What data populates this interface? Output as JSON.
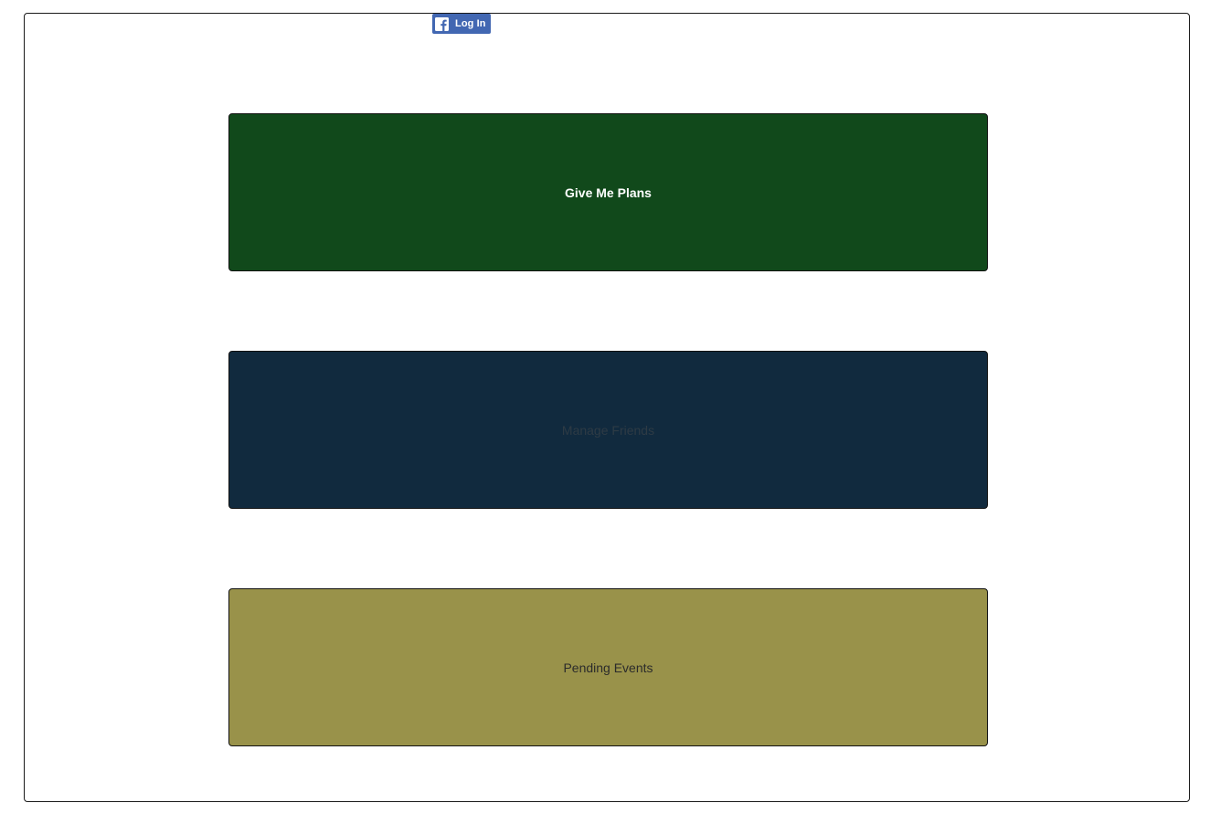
{
  "auth": {
    "facebook_login_label": "Log In",
    "facebook_icon": "facebook-f-icon"
  },
  "actions": {
    "give_me_plans_label": "Give Me Plans",
    "manage_friends_label": "Manage Friends",
    "pending_events_label": "Pending Events"
  },
  "colors": {
    "facebook_blue": "#4267b2",
    "plans_green": "#11491b",
    "friends_navy": "#112a3e",
    "pending_olive": "#99924a"
  }
}
